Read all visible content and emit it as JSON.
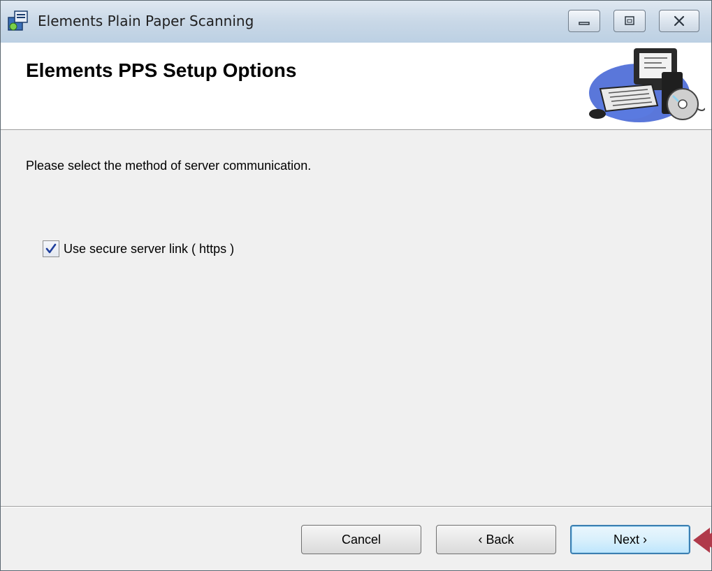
{
  "window": {
    "title": "Elements Plain Paper Scanning",
    "controls": [
      "minimize",
      "maximize",
      "close"
    ]
  },
  "header": {
    "title": "Elements PPS Setup Options",
    "banner_icon": "computer-setup-icon"
  },
  "main": {
    "instruction": "Please select the method of server communication.",
    "secure_link": {
      "label": "Use secure server link ( https )",
      "checked": true
    }
  },
  "footer": {
    "cancel_label": "Cancel",
    "back_label": "‹ Back",
    "next_label": "Next ›"
  },
  "colors": {
    "title_bar": "#c9d8e7",
    "dialog_bg": "#f0f0f0",
    "next_button_border": "#3c7fb1",
    "pointer_marker": "#b03a4a"
  }
}
